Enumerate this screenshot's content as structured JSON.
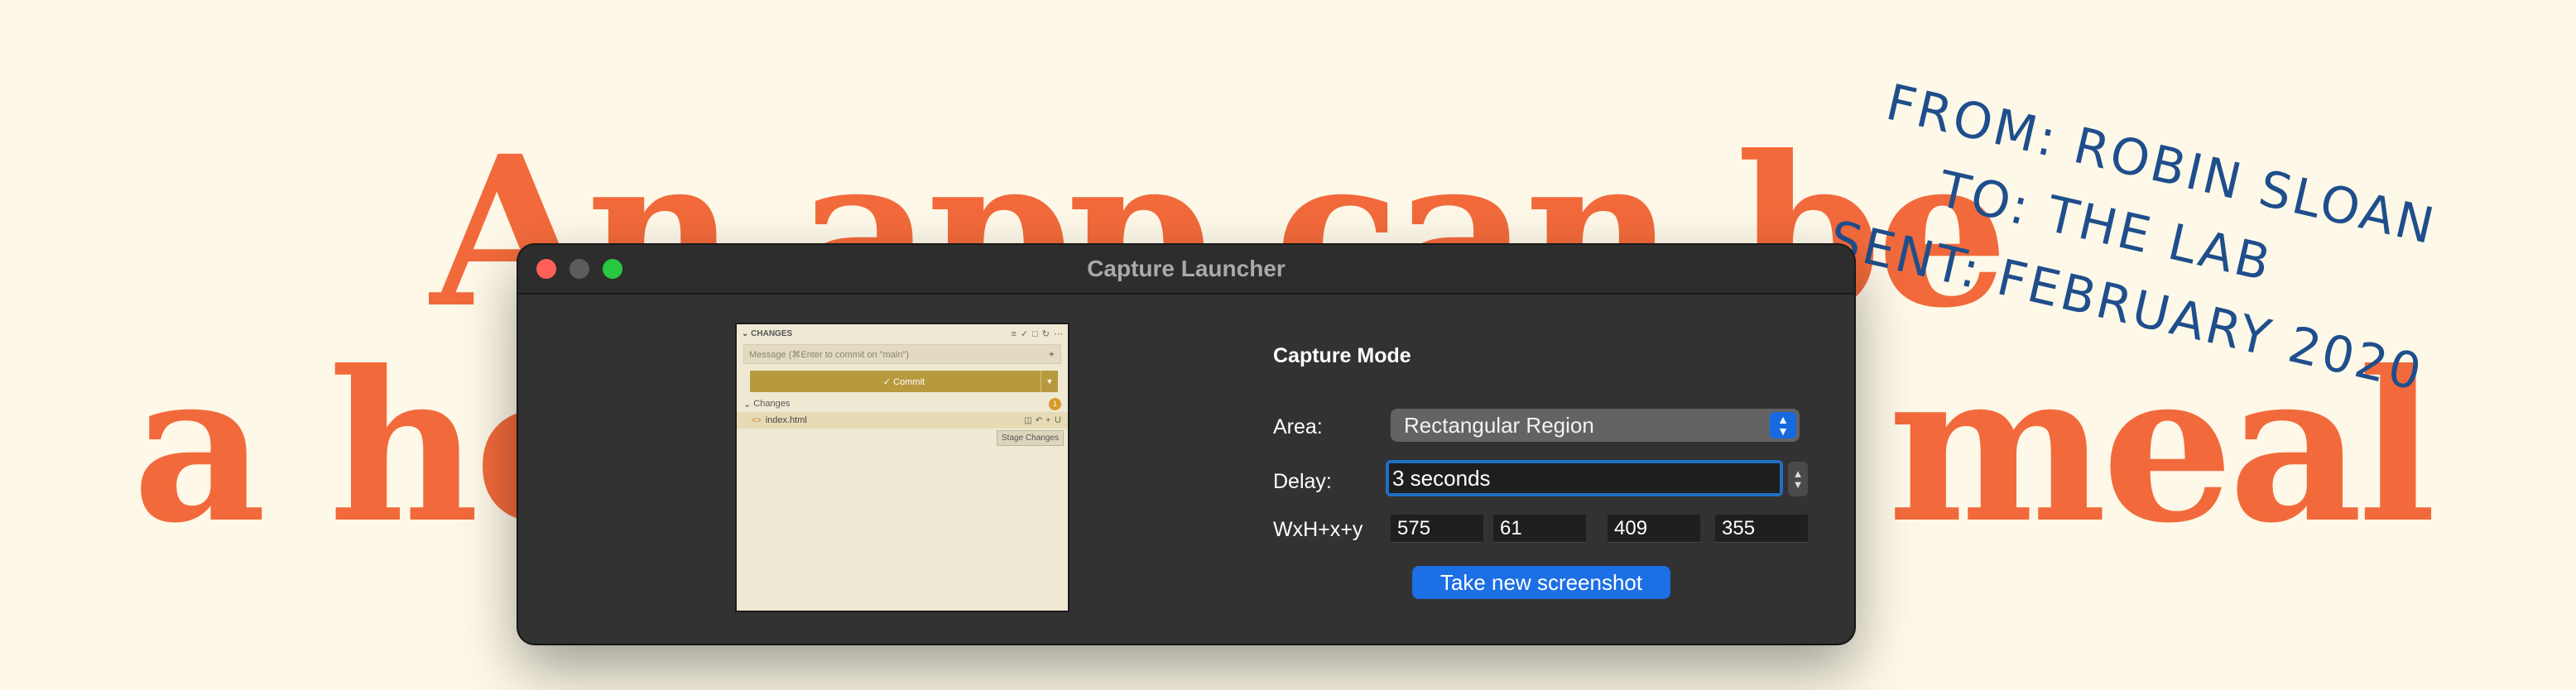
{
  "background": {
    "headline_line1": "An app can be",
    "headline_line2": "a home-cooked meal",
    "letter": {
      "from": "FROM: ROBIN SLOAN",
      "to": "TO: THE LAB",
      "sent": "SENT: FEBRUARY 2020"
    }
  },
  "window": {
    "title": "Capture Launcher",
    "preview": {
      "section_label": "CHANGES",
      "message_placeholder": "Message (⌘Enter to commit on \"main\")",
      "commit_label": "✓ Commit",
      "changes_label": "Changes",
      "changes_count": "1",
      "file_name": "index.html",
      "file_status": "U",
      "tooltip": "Stage Changes"
    },
    "form": {
      "section_title": "Capture Mode",
      "area_label": "Area:",
      "area_value": "Rectangular Region",
      "delay_label": "Delay:",
      "delay_value": "3 seconds",
      "geometry_label": "WxH+x+y",
      "width": "575",
      "height": "61",
      "x": "409",
      "y": "355",
      "button_label": "Take new screenshot"
    }
  },
  "colors": {
    "headline": "#f26a3b",
    "letter": "#1f4e8c",
    "accent": "#1c6fe4",
    "window_bg": "#323232"
  }
}
